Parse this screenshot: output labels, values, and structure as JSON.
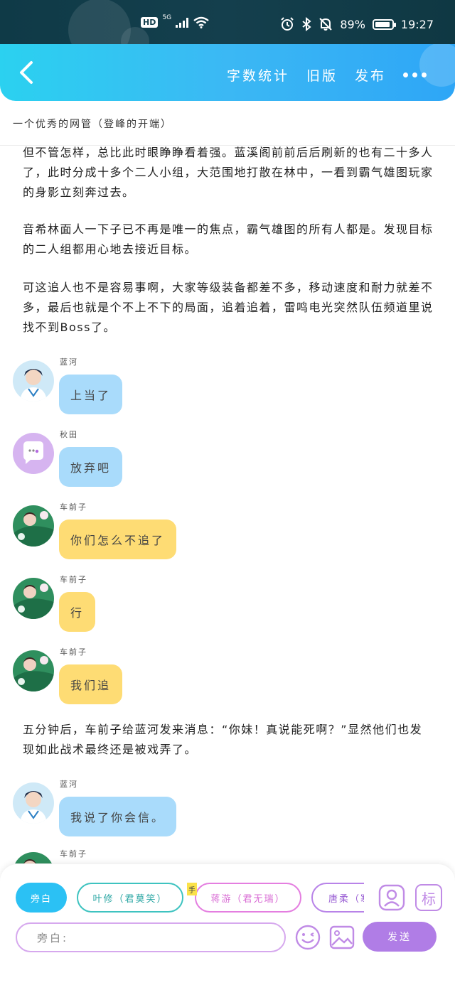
{
  "status_bar": {
    "hd": "HD",
    "signal": "5G",
    "battery_pct": "89%",
    "battery_level": 0.89,
    "time": "19:27"
  },
  "header": {
    "actions": [
      "字数统计",
      "旧版",
      "发布"
    ]
  },
  "story": {
    "title": "一个优秀的网管（登峰的开端）"
  },
  "content": {
    "narration_1": "但不管怎样，总比此时眼睁睁看着强。蓝溪阁前前后后刷新的也有二十多人了，此时分成十多个二人小组，大范围地打散在林中，一看到霸气雄图玩家的身影立刻奔过去。",
    "narration_2": "音希林面人一下子已不再是唯一的焦点，霸气雄图的所有人都是。发现目标的二人组都用心地去接近目标。",
    "narration_3": "可这追人也不是容易事啊，大家等级装备都差不多，移动速度和耐力就差不多，最后也就是个不上不下的局面，追着追着，雷鸣电光突然队伍频道里说找不到Boss了。",
    "narration_4": "五分钟后，车前子给蓝河发来消息：“你妹！真说能死啊？”显然他们也发现如此战术最终还是被戏弄了。",
    "messages": [
      {
        "sender": "蓝河",
        "text": "上当了",
        "style": "blue",
        "avatar": "boy"
      },
      {
        "sender": "秋田",
        "text": "放弃吧",
        "style": "blue",
        "avatar": "chat"
      },
      {
        "sender": "车前子",
        "text": "你们怎么不追了",
        "style": "yellow",
        "avatar": "flower"
      },
      {
        "sender": "车前子",
        "text": "行",
        "style": "yellow",
        "avatar": "flower"
      },
      {
        "sender": "车前子",
        "text": "我们追",
        "style": "yellow",
        "avatar": "flower"
      },
      {
        "sender": "蓝河",
        "text": "我说了你会信。",
        "style": "blue",
        "avatar": "boy"
      },
      {
        "sender": "车前子",
        "text": "",
        "style": "yellow",
        "avatar": "flower"
      }
    ]
  },
  "composer": {
    "roles": [
      "旁白",
      "叶修（君莫笑）",
      "蒋游（君无瑞）",
      "唐柔（寒"
    ],
    "hand_badge": "手",
    "icon_label": "标",
    "input_placeholder": "旁白:",
    "send_label": "发送"
  },
  "colors": {
    "header_start": "#2bd1f0",
    "header_end": "#2ea6f6",
    "bubble_blue": "#a9dbfb",
    "bubble_yellow": "#fedc74",
    "send_purple": "#b07de6"
  }
}
